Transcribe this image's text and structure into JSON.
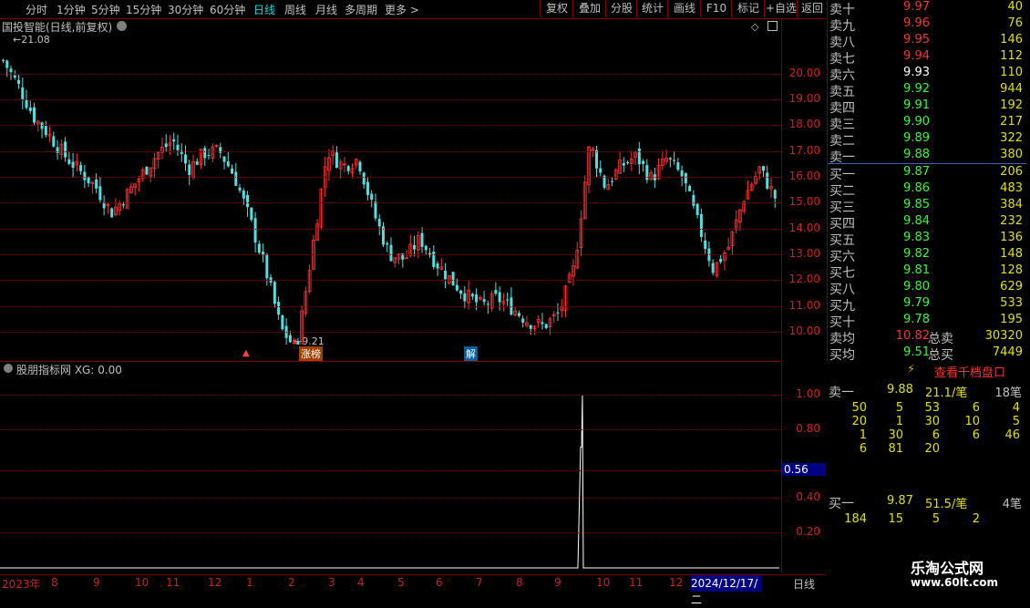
{
  "toolbar": {
    "periods": [
      "分时",
      "1分钟",
      "5分钟",
      "15分钟",
      "30分钟",
      "60分钟",
      "日线",
      "周线",
      "月线",
      "多周期",
      "更多 >"
    ],
    "active_period": "日线",
    "buttons": [
      "复权",
      "叠加",
      "分股",
      "统计",
      "画线",
      "F10",
      "标记",
      "+自选",
      "返回"
    ]
  },
  "main_chart": {
    "title": "国投智能(日线,前复权)",
    "high_marker": "21.08",
    "low_marker": "9.21",
    "tags": [
      "涨榜",
      "解"
    ],
    "price_axis": [
      "20.00",
      "19.00",
      "18.00",
      "17.00",
      "16.00",
      "15.00",
      "14.00",
      "13.00",
      "12.00",
      "11.00",
      "10.00"
    ]
  },
  "sub_chart": {
    "title": "股朋指标网 XG: 0.00",
    "axis": [
      "1.00",
      "0.80",
      "0.56",
      "0.40",
      "0.20"
    ],
    "highlight_value": "0.56"
  },
  "date_axis": {
    "labels": [
      "2023年",
      "8",
      "9",
      "10",
      "11",
      "12",
      "1",
      "2",
      "3",
      "4",
      "5",
      "6",
      "7",
      "8",
      "9",
      "10",
      "11",
      "12"
    ],
    "highlight": "2024/12/17/二",
    "period_tag": "日线"
  },
  "order_book": {
    "asks": [
      {
        "label": "卖十",
        "price": "9.97",
        "vol": "40",
        "cls": "up"
      },
      {
        "label": "卖九",
        "price": "9.96",
        "vol": "76",
        "cls": "up"
      },
      {
        "label": "卖八",
        "price": "9.95",
        "vol": "146",
        "cls": "up"
      },
      {
        "label": "卖七",
        "price": "9.94",
        "vol": "112",
        "cls": "up"
      },
      {
        "label": "卖六",
        "price": "9.93",
        "vol": "110",
        "cls": "flat"
      },
      {
        "label": "卖五",
        "price": "9.92",
        "vol": "944",
        "cls": "down"
      },
      {
        "label": "卖四",
        "price": "9.91",
        "vol": "192",
        "cls": "down"
      },
      {
        "label": "卖三",
        "price": "9.90",
        "vol": "217",
        "cls": "down"
      },
      {
        "label": "卖二",
        "price": "9.89",
        "vol": "322",
        "cls": "down"
      },
      {
        "label": "卖一",
        "price": "9.88",
        "vol": "380",
        "cls": "down"
      }
    ],
    "bids": [
      {
        "label": "买一",
        "price": "9.87",
        "vol": "206",
        "cls": "down"
      },
      {
        "label": "买二",
        "price": "9.86",
        "vol": "483",
        "cls": "down"
      },
      {
        "label": "买三",
        "price": "9.85",
        "vol": "384",
        "cls": "down"
      },
      {
        "label": "买四",
        "price": "9.84",
        "vol": "232",
        "cls": "down"
      },
      {
        "label": "买五",
        "price": "9.83",
        "vol": "136",
        "cls": "down"
      },
      {
        "label": "买六",
        "price": "9.82",
        "vol": "148",
        "cls": "down"
      },
      {
        "label": "买七",
        "price": "9.81",
        "vol": "128",
        "cls": "down"
      },
      {
        "label": "买八",
        "price": "9.80",
        "vol": "629",
        "cls": "down"
      },
      {
        "label": "买九",
        "price": "9.79",
        "vol": "533",
        "cls": "down"
      },
      {
        "label": "买十",
        "price": "9.78",
        "vol": "195",
        "cls": "down"
      }
    ],
    "avg_sell_label": "卖均",
    "avg_sell": "10.82",
    "total_sell_label": "总卖",
    "total_sell": "30320",
    "avg_buy_label": "买均",
    "avg_buy": "9.51",
    "total_buy_label": "总买",
    "total_buy": "7449"
  },
  "qiandang": {
    "label": "查看千档盘口"
  },
  "detail": {
    "sell1": {
      "label": "卖一",
      "price": "9.88",
      "per": "21.1/笔",
      "count": "18笔"
    },
    "sell_grid": [
      [
        "50",
        "5",
        "53",
        "6",
        "4"
      ],
      [
        "20",
        "1",
        "30",
        "10",
        "5"
      ],
      [
        "1",
        "30",
        "6",
        "6",
        "46"
      ],
      [
        "6",
        "81",
        "20"
      ]
    ],
    "buy1": {
      "label": "买一",
      "price": "9.87",
      "per": "51.5/笔",
      "count": "4笔"
    },
    "buy_grid": [
      [
        "184",
        "15",
        "5",
        "2"
      ]
    ]
  },
  "watermark": {
    "line1": "乐淘公式网",
    "line2": "www.60lt.com"
  },
  "colors": {
    "up": "#ff3030",
    "down": "#30ff30",
    "axis": "#d02020",
    "accent": "#00e0e0"
  },
  "chart_data": {
    "type": "candlestick",
    "title": "国投智能(日线,前复权)",
    "x": [
      "2023-07",
      "2023-08",
      "2023-09",
      "2023-10",
      "2023-11",
      "2023-12",
      "2024-01",
      "2024-02",
      "2024-03",
      "2024-04",
      "2024-05",
      "2024-06",
      "2024-07",
      "2024-08",
      "2024-09",
      "2024-10",
      "2024-11",
      "2024-12"
    ],
    "close_path": [
      20.5,
      19.5,
      18.3,
      17.6,
      16.8,
      16.2,
      15.6,
      14.6,
      15.3,
      16.1,
      16.9,
      17.4,
      16.3,
      16.9,
      17.0,
      16.0,
      14.3,
      12.4,
      10.1,
      9.3,
      13.1,
      17.0,
      16.4,
      16.7,
      14.6,
      13.0,
      12.8,
      13.6,
      12.7,
      12.0,
      11.4,
      11.0,
      11.3,
      10.9,
      10.4,
      10.2,
      10.7,
      12.5,
      17.3,
      15.6,
      16.4,
      16.8,
      15.9,
      16.7,
      16.0,
      14.2,
      12.4,
      13.3,
      15.2,
      16.3,
      15.2
    ],
    "ylim": [
      9.5,
      21.5
    ],
    "high": 21.08,
    "low": 9.21,
    "indicator": {
      "name": "XG",
      "spike_position": 0.745,
      "spike_value": 1.0,
      "ylim": [
        0,
        1.1
      ]
    }
  }
}
